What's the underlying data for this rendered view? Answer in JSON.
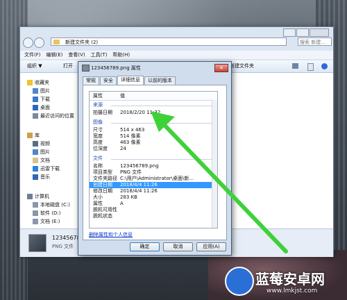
{
  "explorer": {
    "address": "新建文件夹 (2)",
    "search_placeholder": "搜索 新建...",
    "menu": [
      "文件(F)",
      "编辑(E)",
      "查看(V)",
      "工具(T)",
      "帮助(H)"
    ],
    "toolbar": {
      "organize": "组织 ▼",
      "open": "打开",
      "new_folder": "新建文件夹"
    },
    "sidebar": [
      "收藏夹",
      "图片",
      "下载",
      "桌面",
      "最近访问的位置",
      "库",
      "视频",
      "图片",
      "文档",
      "迅雷下载",
      "音乐",
      "计算机",
      "本地磁盘 (C:)",
      "软件 (D:)",
      "文档 (E:)"
    ],
    "details": {
      "name": "123456789.",
      "type": "PNG 文件"
    }
  },
  "dialog": {
    "title": "123456789.png 属性",
    "close": "✕",
    "tabs": [
      "常规",
      "安全",
      "详细信息",
      "以前的版本"
    ],
    "columns": {
      "prop": "属性",
      "value": "值"
    },
    "sections": {
      "origin": "来源",
      "image": "图像",
      "file": "文件"
    },
    "rows": [
      {
        "k": "拍摄日期",
        "v": "2018/2/20 11:32"
      },
      {
        "k": "尺寸",
        "v": "514 x 463"
      },
      {
        "k": "宽度",
        "v": "514 像素"
      },
      {
        "k": "高度",
        "v": "463 像素"
      },
      {
        "k": "位深度",
        "v": "24"
      },
      {
        "k": "名称",
        "v": "123456789.png"
      },
      {
        "k": "项目类型",
        "v": "PNG 文件"
      },
      {
        "k": "文件夹路径",
        "v": "C:\\用户\\Administrator\\桌面\\新..."
      },
      {
        "k": "创建日期",
        "v": "2018/4/4 11:26"
      },
      {
        "k": "修改日期",
        "v": "2018/4/4 11:26"
      },
      {
        "k": "大小",
        "v": "283 KB"
      },
      {
        "k": "属性",
        "v": "A"
      },
      {
        "k": "脱机可用性",
        "v": ""
      },
      {
        "k": "脱机状态",
        "v": ""
      }
    ],
    "remove_link": "删除属性和个人信息",
    "buttons": {
      "ok": "确定",
      "cancel": "取消",
      "apply": "应用(A)"
    }
  },
  "watermark": {
    "name": "蓝莓安卓网",
    "url": "www.lmkjst.com"
  },
  "colors": {
    "selection": "#3399ff",
    "arrow": "#3fd13a"
  }
}
